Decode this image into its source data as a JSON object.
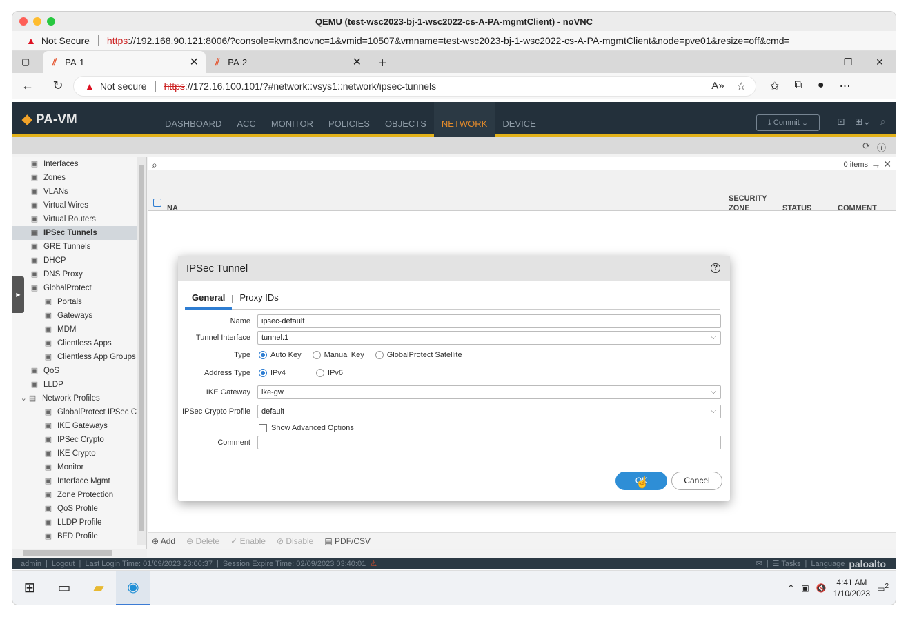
{
  "outer_window": {
    "title": "QEMU (test-wsc2023-bj-1-wsc2022-cs-A-PA-mgmtClient) - noVNC",
    "security_label": "Not Secure",
    "url_scheme": "https",
    "url_rest": "://192.168.90.121:8006/?console=kvm&novnc=1&vmid=10507&vmname=test-wsc2023-bj-1-wsc2022-cs-A-PA-mgmtClient&node=pve01&resize=off&cmd="
  },
  "browser": {
    "tabs": [
      {
        "label": "PA-1"
      },
      {
        "label": "PA-2"
      }
    ],
    "security_label": "Not secure",
    "url_scheme": "https",
    "url_rest": "://172.16.100.101/?#network::vsys1::network/ipsec-tunnels"
  },
  "pa": {
    "logo": "PA-VM",
    "nav": [
      "DASHBOARD",
      "ACC",
      "MONITOR",
      "POLICIES",
      "OBJECTS",
      "NETWORK",
      "DEVICE"
    ],
    "active_nav": "NETWORK",
    "commit_label": "Commit"
  },
  "sidebar": {
    "items": [
      {
        "label": "Interfaces",
        "indent": 0
      },
      {
        "label": "Zones",
        "indent": 0
      },
      {
        "label": "VLANs",
        "indent": 0
      },
      {
        "label": "Virtual Wires",
        "indent": 0
      },
      {
        "label": "Virtual Routers",
        "indent": 0
      },
      {
        "label": "IPSec Tunnels",
        "indent": 0
      },
      {
        "label": "GRE Tunnels",
        "indent": 0
      },
      {
        "label": "DHCP",
        "indent": 0
      },
      {
        "label": "DNS Proxy",
        "indent": 0
      },
      {
        "label": "GlobalProtect",
        "indent": 0
      },
      {
        "label": "Portals",
        "indent": 1
      },
      {
        "label": "Gateways",
        "indent": 1
      },
      {
        "label": "MDM",
        "indent": 1
      },
      {
        "label": "Clientless Apps",
        "indent": 1
      },
      {
        "label": "Clientless App Groups",
        "indent": 1
      },
      {
        "label": "QoS",
        "indent": 0
      },
      {
        "label": "LLDP",
        "indent": 0
      },
      {
        "label": "Network Profiles",
        "indent": 0
      },
      {
        "label": "GlobalProtect IPSec Cry",
        "indent": 1
      },
      {
        "label": "IKE Gateways",
        "indent": 1
      },
      {
        "label": "IPSec Crypto",
        "indent": 1
      },
      {
        "label": "IKE Crypto",
        "indent": 1
      },
      {
        "label": "Monitor",
        "indent": 1
      },
      {
        "label": "Interface Mgmt",
        "indent": 1
      },
      {
        "label": "Zone Protection",
        "indent": 1
      },
      {
        "label": "QoS Profile",
        "indent": 1
      },
      {
        "label": "LLDP Profile",
        "indent": 1
      },
      {
        "label": "BFD Profile",
        "indent": 1
      }
    ]
  },
  "table": {
    "count": "0 items",
    "col_na": "NA",
    "col_zone_1": "SECURITY",
    "col_zone_2": "ZONE",
    "col_status": "STATUS",
    "col_comment": "COMMENT"
  },
  "toolbar": {
    "add": "Add",
    "delete": "Delete",
    "enable": "Enable",
    "disable": "Disable",
    "pdf": "PDF/CSV"
  },
  "status": {
    "user": "admin",
    "logout": "Logout",
    "last_login": "Last Login Time: 01/09/2023 23:06:37",
    "session": "Session Expire Time: 02/09/2023 03:40:01",
    "tasks": "Tasks",
    "language": "Language",
    "brand": "paloalto"
  },
  "dialog": {
    "title": "IPSec Tunnel",
    "tabs": [
      "General",
      "Proxy IDs"
    ],
    "name_label": "Name",
    "name_value": "ipsec-default",
    "tunnel_label": "Tunnel Interface",
    "tunnel_value": "tunnel.1",
    "type_label": "Type",
    "type_options": [
      "Auto Key",
      "Manual Key",
      "GlobalProtect Satellite"
    ],
    "type_selected": "Auto Key",
    "addr_label": "Address Type",
    "addr_options": [
      "IPv4",
      "IPv6"
    ],
    "addr_selected": "IPv4",
    "ike_label": "IKE Gateway",
    "ike_value": "ike-gw",
    "crypto_label": "IPSec Crypto Profile",
    "crypto_value": "default",
    "advanced_label": "Show Advanced Options",
    "comment_label": "Comment",
    "comment_value": "",
    "ok_label": "OK",
    "cancel_label": "Cancel"
  },
  "taskbar": {
    "time": "4:41 AM",
    "date": "1/10/2023",
    "notifications": "2"
  }
}
